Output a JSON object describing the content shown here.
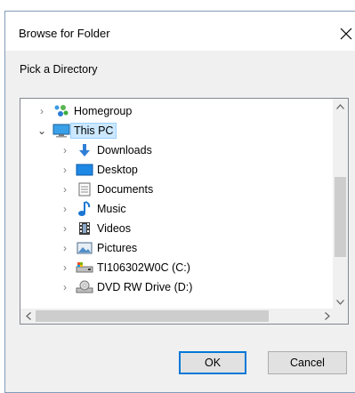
{
  "dialog": {
    "title": "Browse for Folder",
    "prompt": "Pick a Directory",
    "ok_label": "OK",
    "cancel_label": "Cancel"
  },
  "tree": {
    "items": [
      {
        "label": "Homegroup",
        "icon": "homegroup-icon",
        "expanded": false,
        "level": 0
      },
      {
        "label": "This PC",
        "icon": "computer-icon",
        "expanded": true,
        "selected": true,
        "level": 0
      },
      {
        "label": "Downloads",
        "icon": "downloads-icon",
        "expanded": false,
        "level": 1
      },
      {
        "label": "Desktop",
        "icon": "desktop-icon",
        "expanded": false,
        "level": 1
      },
      {
        "label": "Documents",
        "icon": "documents-icon",
        "expanded": false,
        "level": 1
      },
      {
        "label": "Music",
        "icon": "music-icon",
        "expanded": false,
        "level": 1
      },
      {
        "label": "Videos",
        "icon": "videos-icon",
        "expanded": false,
        "level": 1
      },
      {
        "label": "Pictures",
        "icon": "pictures-icon",
        "expanded": false,
        "level": 1
      },
      {
        "label": "TI106302W0C (C:)",
        "icon": "drive-icon",
        "expanded": false,
        "level": 1
      },
      {
        "label": "DVD RW Drive (D:)",
        "icon": "dvd-drive-icon",
        "expanded": false,
        "level": 1
      }
    ]
  },
  "colors": {
    "selection_bg": "#cce8ff",
    "default_button_border": "#0078d7"
  }
}
